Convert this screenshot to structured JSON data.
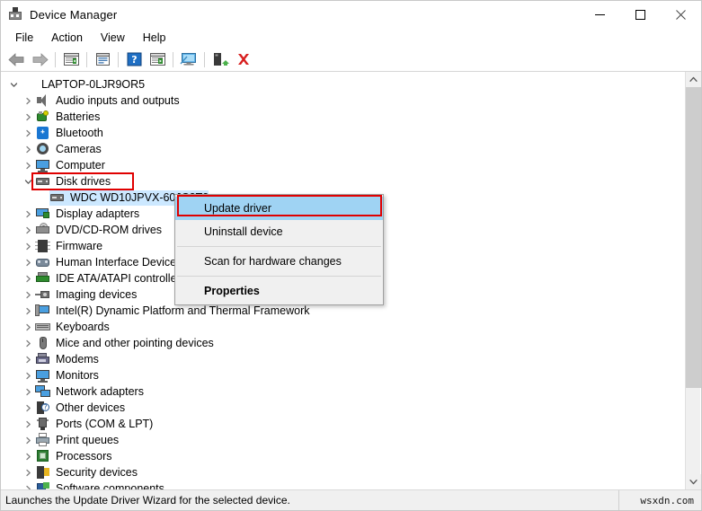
{
  "window": {
    "title": "Device Manager",
    "icon": "device-manager-icon",
    "minimize_label": "—",
    "maximize_label": "□",
    "close_label": "✕"
  },
  "menubar": {
    "items": [
      {
        "label": "File"
      },
      {
        "label": "Action"
      },
      {
        "label": "View"
      },
      {
        "label": "Help"
      }
    ]
  },
  "toolbar": {
    "buttons": [
      {
        "name": "back-icon",
        "label": "Back"
      },
      {
        "name": "forward-icon",
        "label": "Forward"
      },
      {
        "name": "show-hide-console-tree-icon",
        "label": "Show/Hide Console Tree"
      },
      {
        "name": "properties-icon",
        "label": "Properties"
      },
      {
        "name": "help-icon",
        "label": "Help"
      },
      {
        "name": "show-hide-action-pane-icon",
        "label": "Show/Hide Action Pane"
      },
      {
        "name": "scan-for-hardware-changes-icon",
        "label": "Scan for hardware changes"
      },
      {
        "name": "update-driver-icon",
        "label": "Update driver"
      },
      {
        "name": "uninstall-device-icon",
        "label": "Uninstall device"
      }
    ]
  },
  "tree": {
    "root": {
      "label": "LAPTOP-0LJR9OR5",
      "icon": "computer-root-icon",
      "expanded": true
    },
    "items": [
      {
        "label": "Audio inputs and outputs",
        "icon": "speaker-icon",
        "expanded": false,
        "indent": 1
      },
      {
        "label": "Batteries",
        "icon": "battery-icon",
        "expanded": false,
        "indent": 1
      },
      {
        "label": "Bluetooth",
        "icon": "bluetooth-icon",
        "expanded": false,
        "indent": 1
      },
      {
        "label": "Cameras",
        "icon": "camera-icon",
        "expanded": false,
        "indent": 1
      },
      {
        "label": "Computer",
        "icon": "monitor-icon",
        "expanded": false,
        "indent": 1
      },
      {
        "label": "Disk drives",
        "icon": "disk-drive-icon",
        "expanded": true,
        "indent": 1,
        "highlighted": true
      },
      {
        "label": "WDC WD10JPVX-60JC3T3",
        "icon": "disk-drive-icon",
        "expanded": null,
        "indent": 2,
        "selected": true
      },
      {
        "label": "Display adapters",
        "icon": "display-adapter-icon",
        "expanded": false,
        "indent": 1
      },
      {
        "label": "DVD/CD-ROM drives",
        "icon": "dvd-drive-icon",
        "expanded": false,
        "indent": 1
      },
      {
        "label": "Firmware",
        "icon": "firmware-icon",
        "expanded": false,
        "indent": 1
      },
      {
        "label": "Human Interface Devices",
        "icon": "hid-icon",
        "expanded": false,
        "indent": 1
      },
      {
        "label": "IDE ATA/ATAPI controllers",
        "icon": "ide-controller-icon",
        "expanded": false,
        "indent": 1
      },
      {
        "label": "Imaging devices",
        "icon": "imaging-device-icon",
        "expanded": false,
        "indent": 1
      },
      {
        "label": "Intel(R) Dynamic Platform and Thermal Framework",
        "icon": "intel-platform-icon",
        "expanded": false,
        "indent": 1
      },
      {
        "label": "Keyboards",
        "icon": "keyboard-icon",
        "expanded": false,
        "indent": 1
      },
      {
        "label": "Mice and other pointing devices",
        "icon": "mouse-icon",
        "expanded": false,
        "indent": 1
      },
      {
        "label": "Modems",
        "icon": "modem-icon",
        "expanded": false,
        "indent": 1
      },
      {
        "label": "Monitors",
        "icon": "monitor-icon",
        "expanded": false,
        "indent": 1
      },
      {
        "label": "Network adapters",
        "icon": "network-adapter-icon",
        "expanded": false,
        "indent": 1
      },
      {
        "label": "Other devices",
        "icon": "other-device-icon",
        "expanded": false,
        "indent": 1
      },
      {
        "label": "Ports (COM & LPT)",
        "icon": "port-icon",
        "expanded": false,
        "indent": 1
      },
      {
        "label": "Print queues",
        "icon": "printer-icon",
        "expanded": false,
        "indent": 1
      },
      {
        "label": "Processors",
        "icon": "processor-icon",
        "expanded": false,
        "indent": 1
      },
      {
        "label": "Security devices",
        "icon": "security-device-icon",
        "expanded": false,
        "indent": 1
      },
      {
        "label": "Software components",
        "icon": "software-component-icon",
        "expanded": false,
        "indent": 1
      }
    ]
  },
  "context_menu": {
    "items": [
      {
        "label": "Update driver",
        "highlighted": true,
        "bold": false
      },
      {
        "label": "Uninstall device",
        "highlighted": false,
        "bold": false
      },
      {
        "separator": true
      },
      {
        "label": "Scan for hardware changes",
        "highlighted": false,
        "bold": false
      },
      {
        "separator": true
      },
      {
        "label": "Properties",
        "highlighted": false,
        "bold": true
      }
    ]
  },
  "statusbar": {
    "message": "Launches the Update Driver Wizard for the selected device.",
    "watermark": "wsxdn.com"
  },
  "colors": {
    "annotation_red": "#e00000",
    "menu_highlight": "#9fd3f3",
    "tree_selection": "#cce8ff",
    "chrome_bg": "#f0f0f0"
  }
}
